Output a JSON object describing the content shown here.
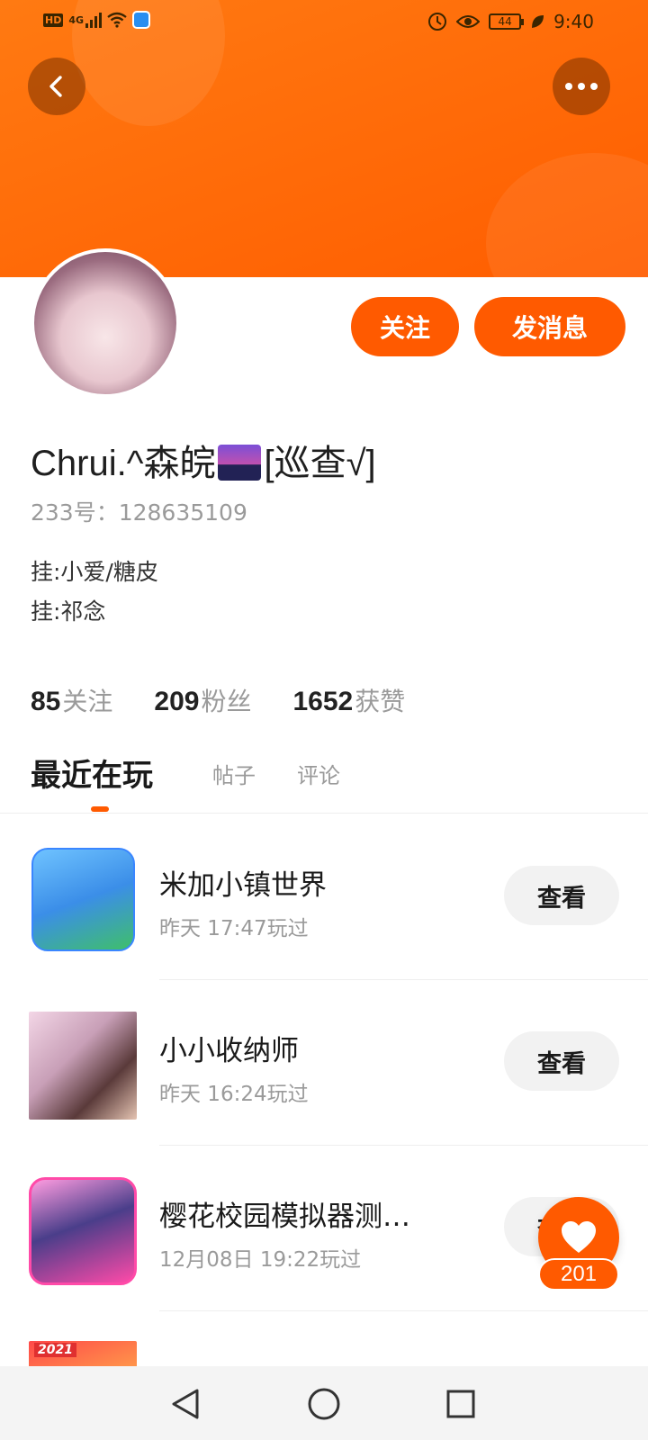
{
  "status_bar": {
    "hd": "HD",
    "network": "4G",
    "battery": "44",
    "time": "9:40"
  },
  "header": {
    "back_icon": "chevron-left-icon",
    "more_icon": "more-dots-icon"
  },
  "profile": {
    "follow_label": "关注",
    "message_label": "发消息",
    "name_prefix": "Chrui.^森皖",
    "name_suffix": "[巡查√]",
    "id_label": "233号：",
    "id_value": "128635109",
    "bio": [
      "挂:小爱/糖皮",
      "挂:祁念"
    ]
  },
  "stats": [
    {
      "num": "85",
      "label": "关注"
    },
    {
      "num": "209",
      "label": "粉丝"
    },
    {
      "num": "1652",
      "label": "获赞"
    }
  ],
  "tabs": [
    {
      "label": "最近在玩",
      "active": true
    },
    {
      "label": "帖子",
      "active": false
    },
    {
      "label": "评论",
      "active": false
    }
  ],
  "games": [
    {
      "name": "米加小镇世界",
      "played": "昨天 17:47玩过",
      "button": "查看"
    },
    {
      "name": "小小收纳师",
      "played": "昨天 16:24玩过",
      "button": "查看"
    },
    {
      "name": "樱花校园模拟器测…",
      "played": "12月08日 19:22玩过",
      "button": "查看"
    },
    {
      "name": "",
      "played": "",
      "button": "",
      "tag": "2021"
    }
  ],
  "like": {
    "count": "201"
  },
  "colors": {
    "accent": "#ff5a00",
    "header": "#ff7a12"
  }
}
